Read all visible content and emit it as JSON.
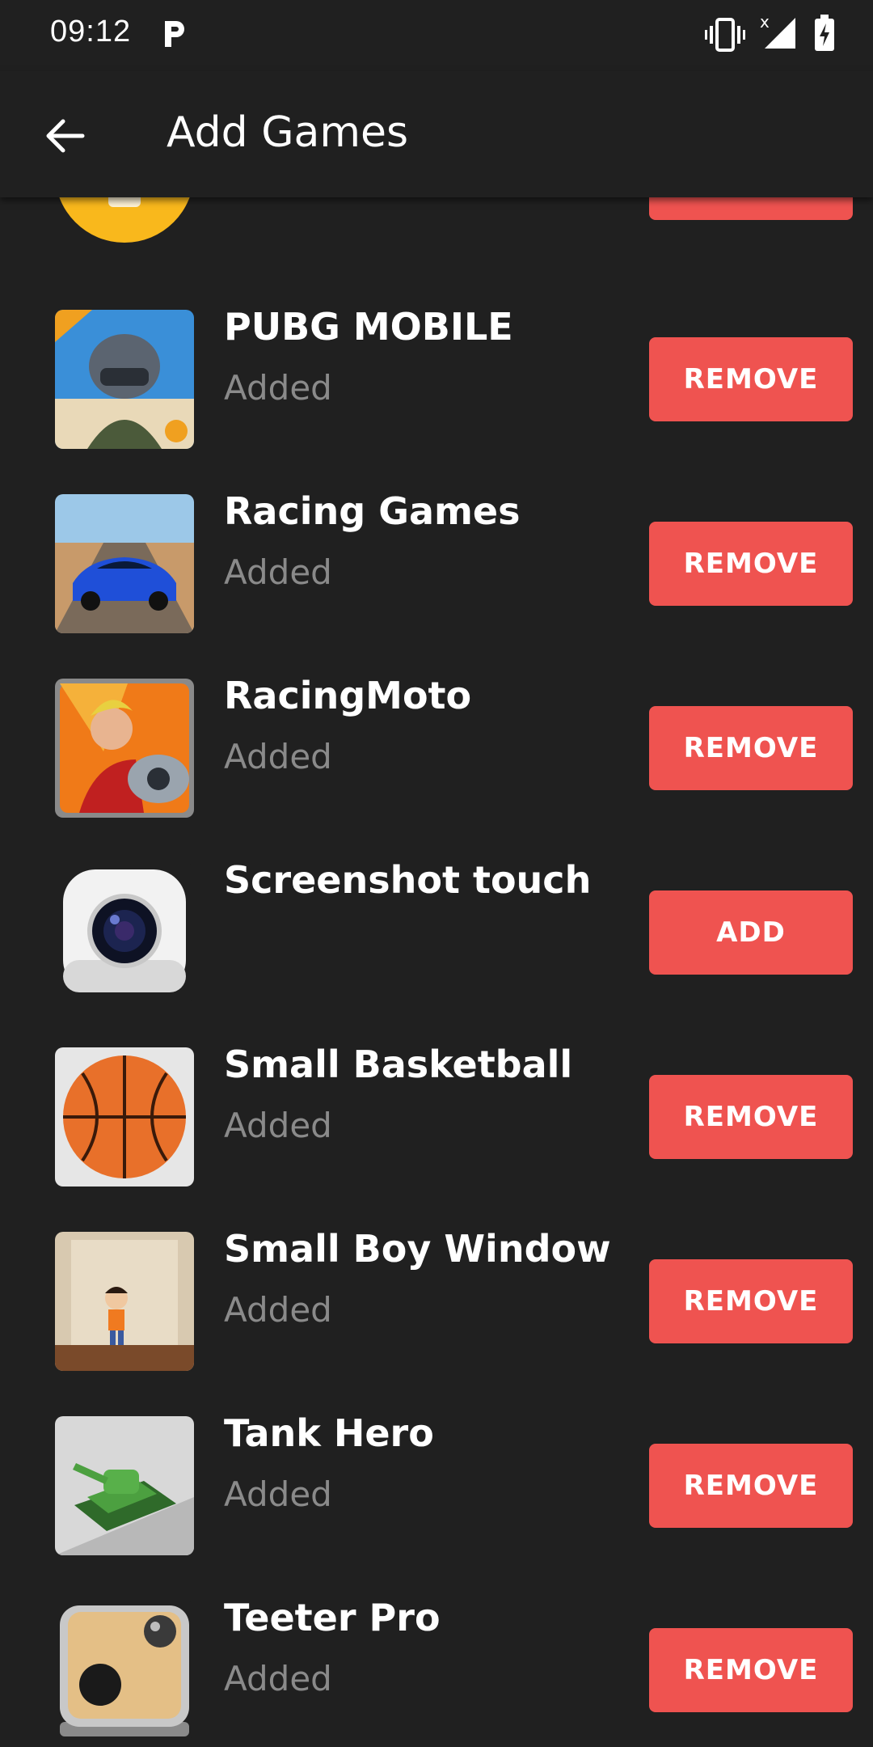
{
  "status_bar": {
    "time": "09:12"
  },
  "header": {
    "title": "Add Games"
  },
  "colors": {
    "background": "#202020",
    "accent_button": "#ef5350",
    "status_text": "#8a8a8a"
  },
  "games": [
    {
      "name": "PUBG MOBILE",
      "status": "Added",
      "action": "REMOVE",
      "icon": "pubg-icon"
    },
    {
      "name": "Racing Games",
      "status": "Added",
      "action": "REMOVE",
      "icon": "racing-car-icon"
    },
    {
      "name": "RacingMoto",
      "status": "Added",
      "action": "REMOVE",
      "icon": "racing-moto-icon"
    },
    {
      "name": "Screenshot touch",
      "status": "",
      "action": "ADD",
      "icon": "camera-lens-icon"
    },
    {
      "name": "Small Basketball",
      "status": "Added",
      "action": "REMOVE",
      "icon": "basketball-icon"
    },
    {
      "name": "Small Boy Window",
      "status": "Added",
      "action": "REMOVE",
      "icon": "small-boy-icon"
    },
    {
      "name": "Tank Hero",
      "status": "Added",
      "action": "REMOVE",
      "icon": "tank-icon"
    },
    {
      "name": "Teeter Pro",
      "status": "Added",
      "action": "REMOVE",
      "icon": "teeter-ball-icon"
    }
  ]
}
